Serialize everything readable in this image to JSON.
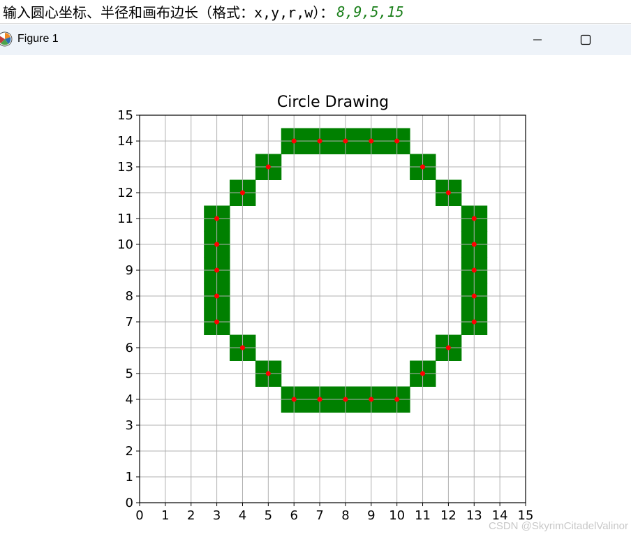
{
  "console": {
    "prompt": "输入圆心坐标、半径和画布边长（格式：x,y,r,w）：",
    "answer": "8,9,5,15"
  },
  "window": {
    "title": "Figure 1",
    "icon": "matplotlib-logo-icon",
    "minimize_icon": "minimize-icon",
    "maximize_icon": "maximize-icon"
  },
  "chart_data": {
    "type": "heatmap",
    "title": "Circle Drawing",
    "xlabel": "",
    "ylabel": "",
    "xlim": [
      0,
      15
    ],
    "ylim": [
      0,
      15
    ],
    "xticks": [
      0,
      1,
      2,
      3,
      4,
      5,
      6,
      7,
      8,
      9,
      10,
      11,
      12,
      13,
      14,
      15
    ],
    "yticks": [
      0,
      1,
      2,
      3,
      4,
      5,
      6,
      7,
      8,
      9,
      10,
      11,
      12,
      13,
      14,
      15
    ],
    "grid": true,
    "cell_color": "#008000",
    "point_color": "#ff0000",
    "points": [
      [
        6,
        14
      ],
      [
        7,
        14
      ],
      [
        8,
        14
      ],
      [
        9,
        14
      ],
      [
        10,
        14
      ],
      [
        5,
        13
      ],
      [
        11,
        13
      ],
      [
        4,
        12
      ],
      [
        12,
        12
      ],
      [
        3,
        11
      ],
      [
        13,
        11
      ],
      [
        3,
        10
      ],
      [
        13,
        10
      ],
      [
        3,
        9
      ],
      [
        13,
        9
      ],
      [
        3,
        8
      ],
      [
        13,
        8
      ],
      [
        3,
        7
      ],
      [
        13,
        7
      ],
      [
        4,
        6
      ],
      [
        12,
        6
      ],
      [
        5,
        5
      ],
      [
        11,
        5
      ],
      [
        6,
        4
      ],
      [
        7,
        4
      ],
      [
        8,
        4
      ],
      [
        9,
        4
      ],
      [
        10,
        4
      ]
    ]
  },
  "watermark": "CSDN @SkyrimCitadelValinor"
}
